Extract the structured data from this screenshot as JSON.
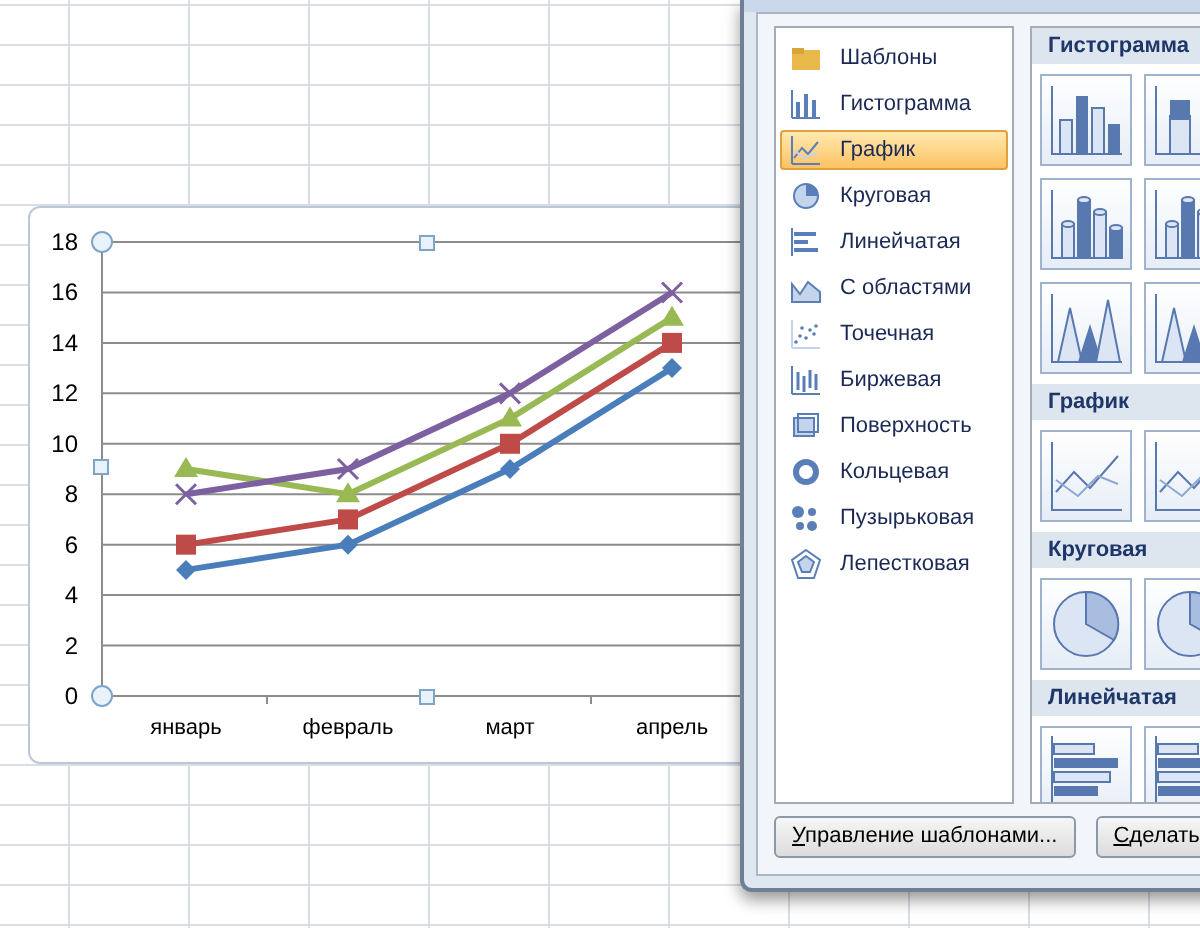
{
  "chart": {
    "chart_data": {
      "type": "line",
      "grid": true,
      "categories": [
        "январь",
        "февраль",
        "март",
        "апрель"
      ],
      "ylim": [
        0,
        18
      ],
      "yticks": [
        0,
        2,
        4,
        6,
        8,
        10,
        12,
        14,
        16,
        18
      ],
      "series": [
        {
          "color": "#4a7ebb",
          "marker": "diamond",
          "values": [
            5,
            6,
            9,
            13
          ]
        },
        {
          "color": "#be4b48",
          "marker": "square",
          "values": [
            6,
            7,
            10,
            14
          ]
        },
        {
          "color": "#98b954",
          "marker": "triangle",
          "values": [
            9,
            8,
            11,
            15
          ]
        },
        {
          "color": "#7d60a0",
          "marker": "cross",
          "values": [
            8,
            9,
            12,
            16
          ]
        }
      ]
    }
  },
  "dialog": {
    "chart_types": [
      {
        "label": "Шаблоны",
        "kind": "folder",
        "selected": false
      },
      {
        "label": "Гистограмма",
        "kind": "column",
        "selected": false
      },
      {
        "label": "График",
        "kind": "line",
        "selected": true
      },
      {
        "label": "Круговая",
        "kind": "pie",
        "selected": false
      },
      {
        "label": "Линейчатая",
        "kind": "bar",
        "selected": false
      },
      {
        "label": "С областями",
        "kind": "area",
        "selected": false
      },
      {
        "label": "Точечная",
        "kind": "scatter",
        "selected": false
      },
      {
        "label": "Биржевая",
        "kind": "stock",
        "selected": false
      },
      {
        "label": "Поверхность",
        "kind": "surface",
        "selected": false
      },
      {
        "label": "Кольцевая",
        "kind": "doughnut",
        "selected": false
      },
      {
        "label": "Пузырьковая",
        "kind": "bubble",
        "selected": false
      },
      {
        "label": "Лепестковая",
        "kind": "radar",
        "selected": false
      }
    ],
    "gallery": [
      {
        "title": "Гистограмма",
        "thumbnails": [
          {
            "kind": "column"
          },
          {
            "kind": "stacked-column"
          },
          {
            "kind": "cylinder"
          },
          {
            "kind": "stacked-cylinder"
          },
          {
            "kind": "cone"
          },
          {
            "kind": "stacked-cone"
          }
        ]
      },
      {
        "title": "График",
        "thumbnails": [
          {
            "kind": "line"
          },
          {
            "kind": "stacked-line"
          }
        ]
      },
      {
        "title": "Круговая",
        "thumbnails": [
          {
            "kind": "pie"
          },
          {
            "kind": "pie-3d"
          }
        ]
      },
      {
        "title": "Линейчатая",
        "thumbnails": [
          {
            "kind": "bar"
          },
          {
            "kind": "stacked-bar"
          }
        ]
      }
    ],
    "buttons": [
      "Управление шаблонами...",
      "Сделать"
    ]
  }
}
